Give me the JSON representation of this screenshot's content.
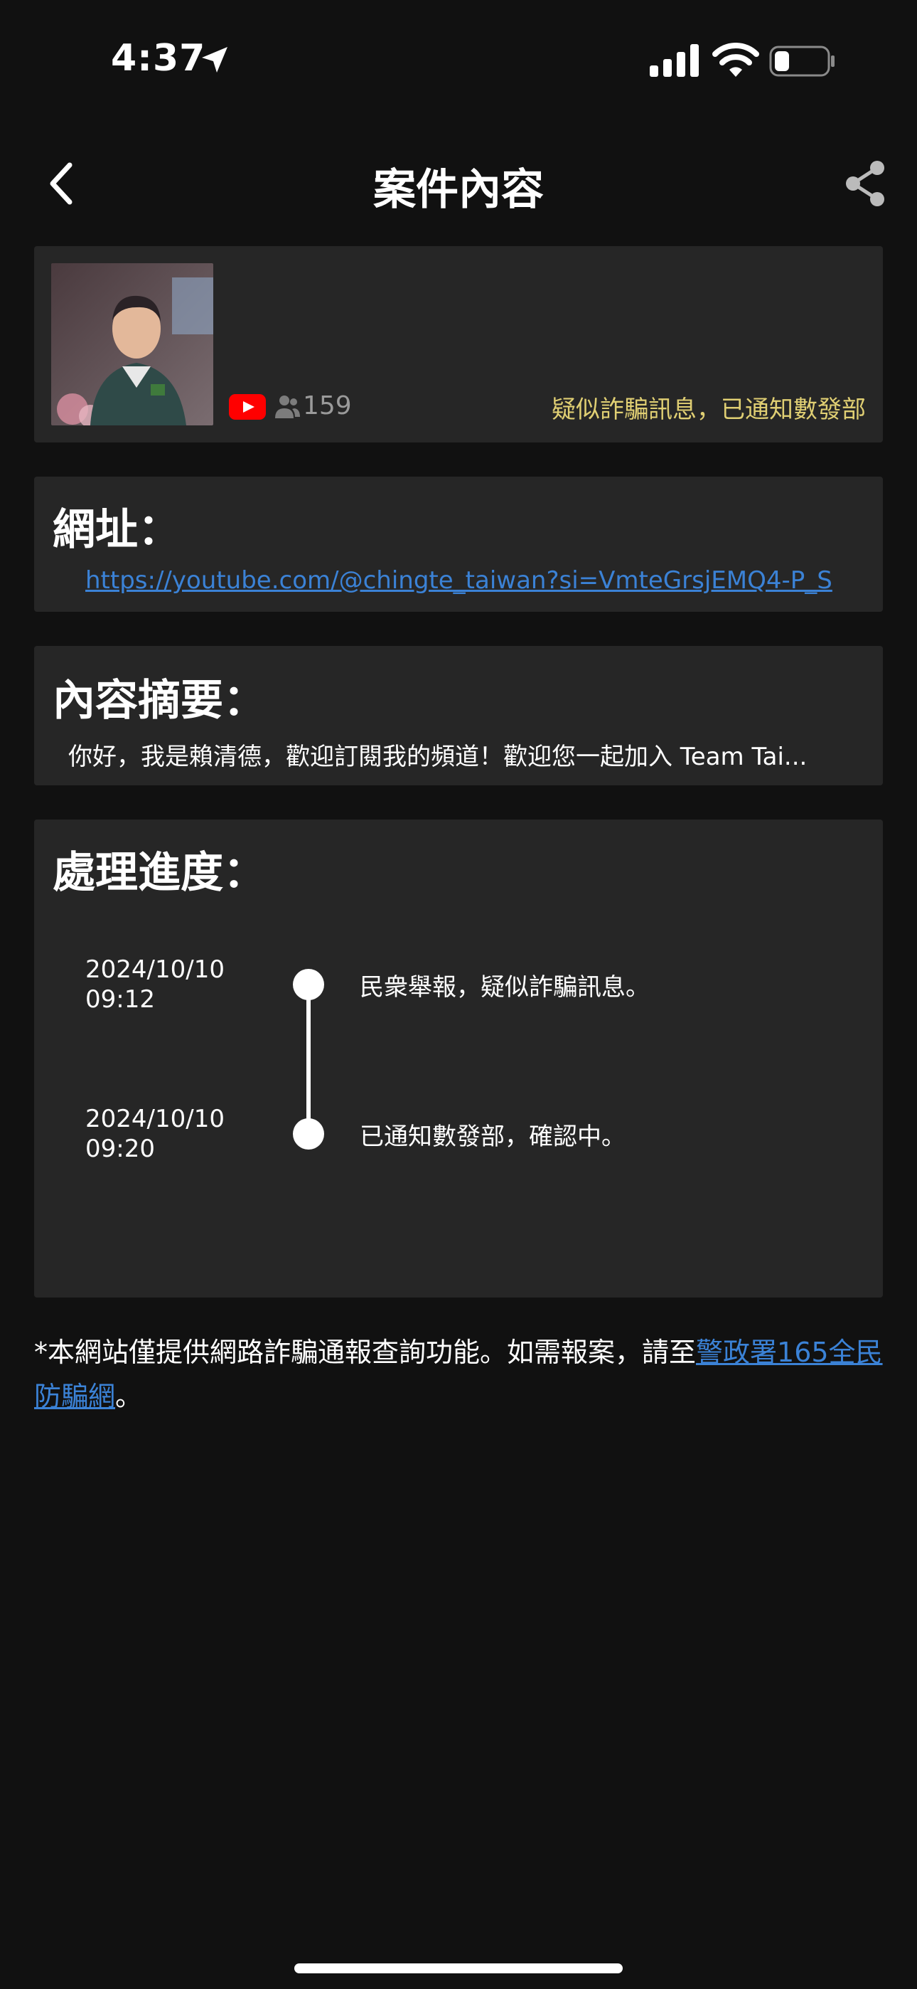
{
  "status_bar": {
    "time": "4:37"
  },
  "nav": {
    "title": "案件內容",
    "back_icon": "chevron-left-icon",
    "share_icon": "share-icon"
  },
  "case": {
    "platform_icon": "youtube-icon",
    "viewer_icon": "people-icon",
    "view_count": "159",
    "status_text": "疑似詐騙訊息，已通知數發部"
  },
  "url_section": {
    "heading": "網址：",
    "url": "https://youtube.com/@chingte_taiwan?si=VmteGrsjEMQ4-P_S"
  },
  "summary_section": {
    "heading": "內容摘要：",
    "text": "你好，我是賴清德，歡迎訂閱我的頻道！歡迎您一起加入 Team Tai..."
  },
  "progress_section": {
    "heading": "處理進度：",
    "events": [
      {
        "date": "2024/10/10",
        "time": "09:12",
        "text": "民衆舉報，疑似詐騙訊息。"
      },
      {
        "date": "2024/10/10",
        "time": "09:20",
        "text": "已通知數發部，確認中。"
      }
    ]
  },
  "footer": {
    "note_prefix": "*本網站僅提供網路詐騙通報查詢功能。如需報案，請至",
    "link_text": "警政署165全民防騙網",
    "note_suffix": "。"
  },
  "colors": {
    "background": "#111111",
    "card": "#262626",
    "status_yellow": "#e0cf73",
    "link_blue": "#3b82d6",
    "youtube_red": "#ff0000"
  }
}
